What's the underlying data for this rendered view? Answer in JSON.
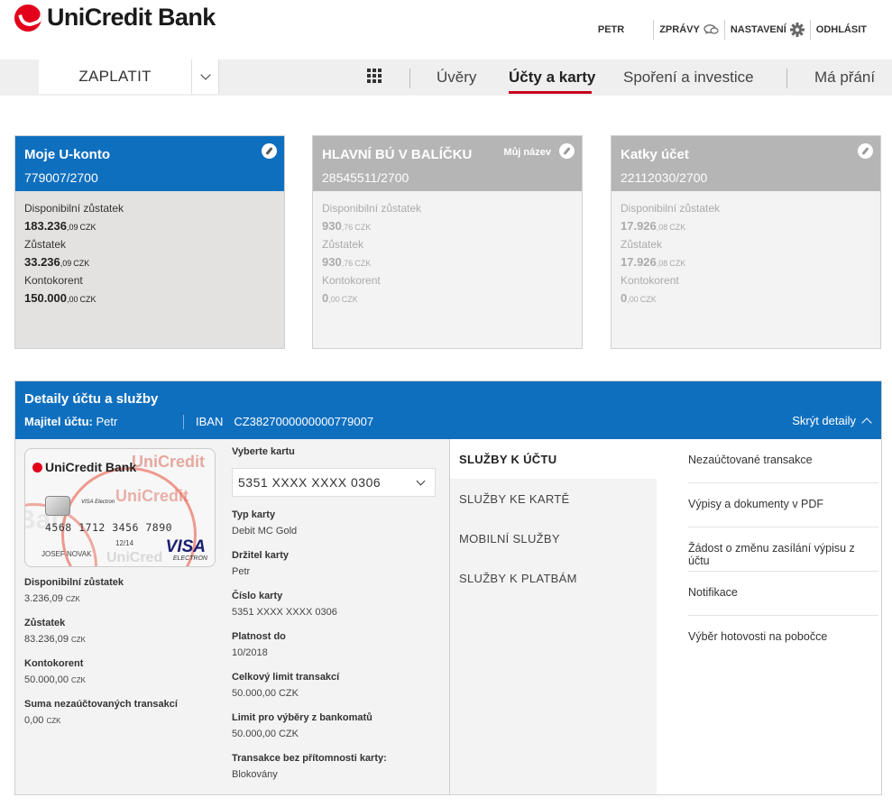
{
  "brand": {
    "name": "UniCredit Bank"
  },
  "toplinks": {
    "user": "PETR",
    "messages": "ZPRÁVY",
    "settings": "NASTAVENÍ",
    "logout": "ODHLÁSIT"
  },
  "nav": {
    "pay": "ZAPLATIT",
    "items": [
      "Úvěry",
      "Účty a karty",
      "Spoření a investice",
      "Má přání"
    ],
    "active_index": 1
  },
  "accounts": [
    {
      "name": "Moje U-konto",
      "number": "779007/2700",
      "selected": true,
      "custom_name_label": "",
      "available_label": "Disponibilní zůstatek",
      "available_int": "183.236",
      "available_dec": ",09",
      "currency": "CZK",
      "balance_label": "Zůstatek",
      "balance_int": "33.236",
      "balance_dec": ",09",
      "overdraft_label": "Kontokorent",
      "overdraft_int": "150.000",
      "overdraft_dec": ",00"
    },
    {
      "name": "HLAVNÍ BÚ V BALÍČKU",
      "number": "28545511/2700",
      "selected": false,
      "custom_name_label": "Můj název",
      "available_label": "Disponibilní zůstatek",
      "available_int": "930",
      "available_dec": ",76",
      "currency": "CZK",
      "balance_label": "Zůstatek",
      "balance_int": "930",
      "balance_dec": ",76",
      "overdraft_label": "Kontokorent",
      "overdraft_int": "0",
      "overdraft_dec": ",00"
    },
    {
      "name": "Katky účet",
      "number": "22112030/2700",
      "selected": false,
      "custom_name_label": "",
      "available_label": "Disponibilní zůstatek",
      "available_int": "17.926",
      "available_dec": ",08",
      "currency": "CZK",
      "balance_label": "Zůstatek",
      "balance_int": "17.926",
      "balance_dec": ",08",
      "overdraft_label": "Kontokorent",
      "overdraft_int": "0",
      "overdraft_dec": ",00"
    }
  ],
  "details": {
    "title": "Detaily účtu a služby",
    "owner_label": "Majitel účtu:",
    "owner": "Petr",
    "iban_label": "IBAN",
    "iban": "CZ3827000000000779007",
    "hide": "Skrýt detaily",
    "card_image": {
      "brand": "UniCredit Bank",
      "number": "4568  1712  3456  7890",
      "holder": "JOSEF NOVAK",
      "expiry": "12/14",
      "network": "VISA",
      "network_sub": "ELECTRON",
      "network_small": "VISA Electron"
    },
    "stats": [
      {
        "label": "Disponibilní zůstatek",
        "int": "3.236",
        "dec": ",09",
        "cur": "CZK"
      },
      {
        "label": "Zůstatek",
        "int": "83.236",
        "dec": ",09",
        "cur": "CZK"
      },
      {
        "label": "Kontokorent",
        "int": "50.000",
        "dec": ",00",
        "cur": "CZK"
      },
      {
        "label": "Suma nezaúčtovaných transakcí",
        "int": "0",
        "dec": ",00",
        "cur": "CZK"
      }
    ],
    "card_picker_label": "Vyberte kartu",
    "card_selected": "5351 XXXX XXXX 0306",
    "card_info": [
      {
        "label": "Typ karty",
        "value": "Debit MC Gold"
      },
      {
        "label": "Držitel karty",
        "value": "Petr"
      },
      {
        "label": "Číslo karty",
        "value": "5351 XXXX XXXX 0306"
      },
      {
        "label": "Platnost do",
        "value": "10/2018"
      },
      {
        "label": "Celkový limit transakcí",
        "value": "50.000,00 CZK"
      },
      {
        "label": "Limit pro výběry z bankomatů",
        "value": "50.000,00 CZK"
      },
      {
        "label": "Transakce bez přítomnosti karty:",
        "value": "Blokovány"
      }
    ],
    "services": [
      "SLUŽBY K ÚČTU",
      "SLUŽBY KE KARTĚ",
      "MOBILNÍ SLUŽBY",
      "SLUŽBY K PLATBÁM"
    ],
    "services_active": 0,
    "links": [
      "Nezaúčtované transakce",
      "Výpisy a dokumenty v PDF",
      "Žádost o změnu zasílání výpisu z účtu",
      "Notifikace",
      "Výběr hotovosti na pobočce"
    ]
  }
}
